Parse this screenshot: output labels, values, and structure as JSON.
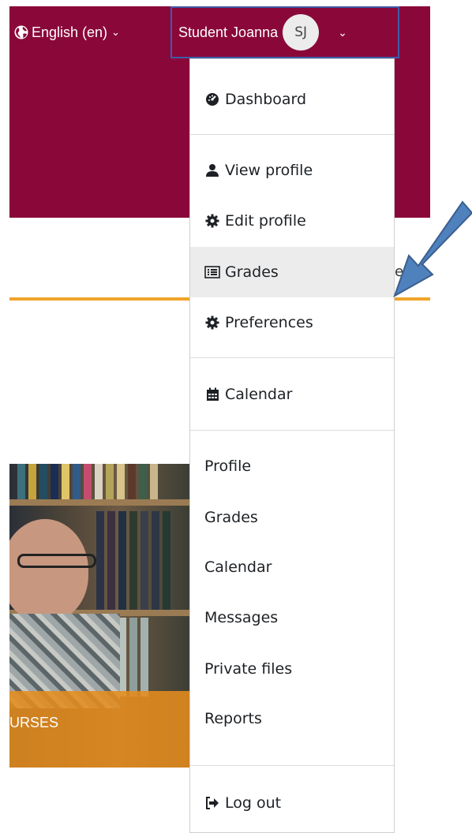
{
  "topnav": {
    "language_label": "English (en)",
    "user_name": "Student Joanna",
    "avatar_initials": "SJ"
  },
  "subnav": {
    "partial_text": "en"
  },
  "hero": {
    "banner_text": "URSES"
  },
  "dropdown": {
    "items": [
      {
        "label": "Dashboard",
        "icon": "dashboard-icon"
      },
      {
        "label": "View profile",
        "icon": "user-icon"
      },
      {
        "label": "Edit profile",
        "icon": "cog-icon"
      },
      {
        "label": "Grades",
        "icon": "table-icon",
        "active": true
      },
      {
        "label": "Preferences",
        "icon": "cog-icon"
      },
      {
        "label": "Calendar",
        "icon": "calendar-icon"
      },
      {
        "label": "Profile"
      },
      {
        "label": "Grades"
      },
      {
        "label": "Calendar"
      },
      {
        "label": "Messages"
      },
      {
        "label": "Private files"
      },
      {
        "label": "Reports"
      },
      {
        "label": "Log out",
        "icon": "sign-out-icon"
      }
    ]
  },
  "colors": {
    "header_bg": "#8a0839",
    "accent_orange": "#f0a32b",
    "pointer_arrow": "#4f81bd",
    "arrow_outline": "#3a5f8f"
  }
}
